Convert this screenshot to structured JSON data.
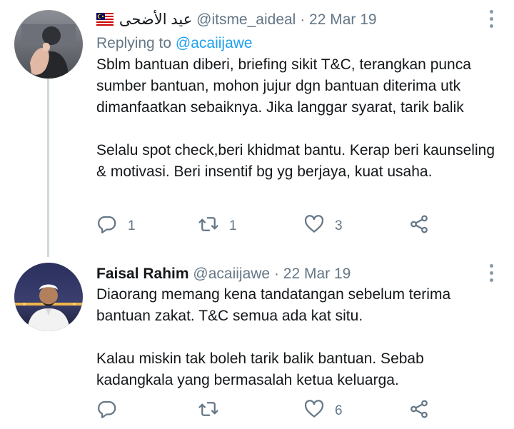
{
  "tweets": [
    {
      "author_name": "عيد الأضحى",
      "author_flag": "malaysia-flag",
      "handle": "@itsme_aideal",
      "separator": "·",
      "date": "22 Mar 19",
      "replying_to_prefix": "Replying to",
      "replying_to_handle": "@acaiijawe",
      "paragraphs": [
        "Sblm bantuan diberi, briefing sikit T&C, terangkan punca sumber bantuan, mohon jujur dgn bantuan diterima utk dimanfaatkan sebaiknya. Jika langgar syarat, tarik balik",
        "Selalu spot check,beri khidmat bantu. Kerap beri kaunseling & motivasi. Beri insentif bg yg berjaya, kuat usaha."
      ],
      "reply_count": "1",
      "retweet_count": "1",
      "like_count": "3"
    },
    {
      "author_name": "Faisal Rahim",
      "handle": "@acaiijawe",
      "separator": "·",
      "date": "22 Mar 19",
      "paragraphs": [
        "Diaorang memang kena tandatangan sebelum terima bantuan zakat. T&C semua ada kat situ.",
        "Kalau miskin tak boleh tarik balik bantuan. Sebab kadangkala yang bermasalah ketua keluarga."
      ],
      "reply_count": "",
      "retweet_count": "",
      "like_count": "6"
    }
  ],
  "icons": {
    "reply": "reply-icon",
    "retweet": "retweet-icon",
    "like": "heart-icon",
    "share": "share-icon",
    "more": "more-vertical-icon"
  },
  "colors": {
    "text": "#14171a",
    "secondary": "#657786",
    "link": "#1da1f2",
    "thread_line": "#cfd9de"
  }
}
